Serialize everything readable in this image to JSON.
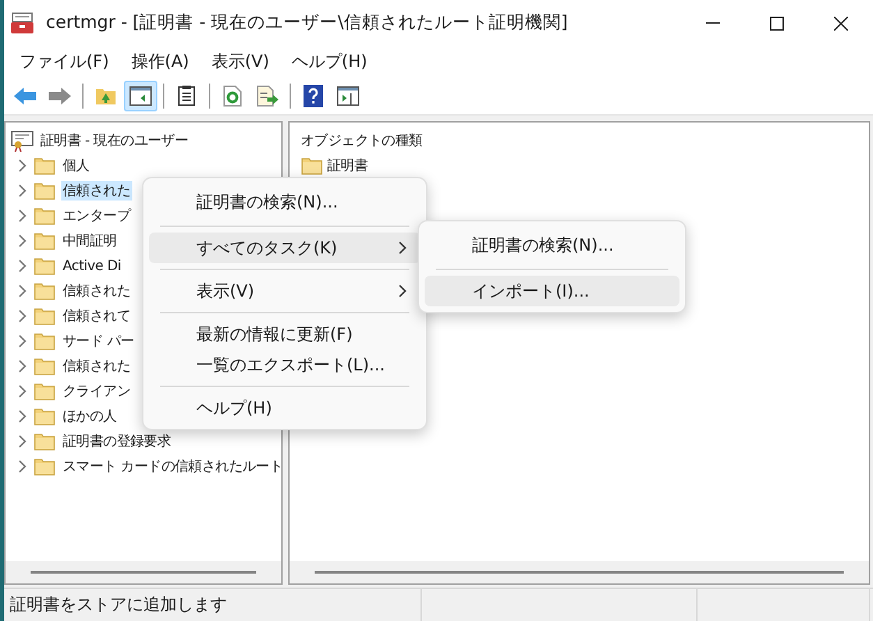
{
  "window": {
    "title": "certmgr - [証明書 - 現在のユーザー\\信頼されたルート証明機関]"
  },
  "menu_bar": [
    "ファイル(F)",
    "操作(A)",
    "表示(V)",
    "ヘルプ(H)"
  ],
  "toolbar": [
    {
      "kind": "back",
      "pressed": false
    },
    {
      "kind": "forward",
      "pressed": false
    },
    {
      "kind": "sep"
    },
    {
      "kind": "up",
      "pressed": false
    },
    {
      "kind": "tree",
      "pressed": true
    },
    {
      "kind": "sep"
    },
    {
      "kind": "clipboard",
      "pressed": false
    },
    {
      "kind": "sep"
    },
    {
      "kind": "refresh",
      "pressed": false
    },
    {
      "kind": "export",
      "pressed": false
    },
    {
      "kind": "sep"
    },
    {
      "kind": "help",
      "pressed": false
    },
    {
      "kind": "pane",
      "pressed": false
    }
  ],
  "tree": {
    "label": "証明書 - 現在のユーザー",
    "children": [
      {
        "label": "個人",
        "selected": false
      },
      {
        "label": "信頼された",
        "selected": true
      },
      {
        "label": "エンタープ",
        "selected": false
      },
      {
        "label": "中間証明",
        "selected": false
      },
      {
        "label": "Active Di",
        "selected": false
      },
      {
        "label": "信頼された",
        "selected": false
      },
      {
        "label": "信頼されて",
        "selected": false
      },
      {
        "label": "サード パー",
        "selected": false
      },
      {
        "label": "信頼された",
        "selected": false
      },
      {
        "label": "クライアン",
        "selected": false
      },
      {
        "label": "ほかの人",
        "selected": false
      },
      {
        "label": "証明書の登録要求",
        "selected": false
      },
      {
        "label": "スマート カードの信頼されたルート",
        "selected": false
      }
    ]
  },
  "right_pane": {
    "column": "オブジェクトの種類",
    "items": [
      "証明書"
    ]
  },
  "context_menu": [
    {
      "kind": "item",
      "label": "証明書の検索(N)...",
      "submenu": false,
      "selected": false
    },
    {
      "kind": "separator"
    },
    {
      "kind": "item",
      "label": "すべてのタスク(K)",
      "submenu": true,
      "selected": true
    },
    {
      "kind": "separator"
    },
    {
      "kind": "item",
      "label": "表示(V)",
      "submenu": true,
      "selected": false
    },
    {
      "kind": "separator"
    },
    {
      "kind": "item",
      "label": "最新の情報に更新(F)",
      "submenu": false,
      "selected": false
    },
    {
      "kind": "item",
      "label": "一覧のエクスポート(L)...",
      "submenu": false,
      "selected": false
    },
    {
      "kind": "separator"
    },
    {
      "kind": "item",
      "label": "ヘルプ(H)",
      "submenu": false,
      "selected": false
    }
  ],
  "submenu": [
    {
      "kind": "item",
      "label": "証明書の検索(N)...",
      "submenu": false,
      "selected": false
    },
    {
      "kind": "separator"
    },
    {
      "kind": "item",
      "label": "インポート(I)...",
      "submenu": false,
      "selected": true
    }
  ],
  "status_bar": {
    "text": "証明書をストアに追加します"
  }
}
